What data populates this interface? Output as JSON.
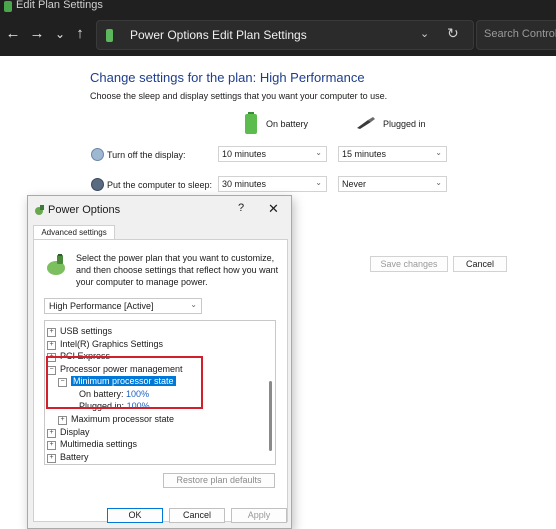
{
  "window": {
    "title": "Edit Plan Settings"
  },
  "nav": {
    "back": "←",
    "forward": "→",
    "recent": "⌄",
    "up": "↑",
    "breadcrumb": [
      "Power Options",
      "Edit Plan Settings"
    ],
    "separator": "›",
    "dropdown": "⌄",
    "refresh": "↻",
    "search_placeholder": "Search Control Pa"
  },
  "main": {
    "heading": "Change settings for the plan: High Performance",
    "subtext": "Choose the sleep and display settings that you want your computer to use.",
    "on_battery": "On battery",
    "plugged_in": "Plugged in",
    "rows": [
      {
        "label": "Turn off the display:",
        "battery": "10 minutes",
        "plugged": "15 minutes"
      },
      {
        "label": "Put the computer to sleep:",
        "battery": "30 minutes",
        "plugged": "Never"
      }
    ],
    "save_changes": "Save changes",
    "cancel": "Cancel"
  },
  "dialog": {
    "title": "Power Options",
    "help": "?",
    "close": "✕",
    "tab": "Advanced settings",
    "description": "Select the power plan that you want to customize, and then choose settings that reflect how you want your computer to manage power.",
    "plan": "High Performance [Active]",
    "tree": [
      {
        "expander": "⊞",
        "label": "USB settings"
      },
      {
        "expander": "⊞",
        "label": "Intel(R) Graphics Settings"
      },
      {
        "expander": "⊞",
        "label": "PCI Express"
      },
      {
        "expander": "⊟",
        "label": "Processor power management"
      },
      {
        "expander": "⊟",
        "label": "Minimum processor state"
      },
      {
        "label": "On battery:",
        "value": "100%"
      },
      {
        "label": "Plugged in:",
        "value": "100%"
      },
      {
        "expander": "⊞",
        "label": "Maximum processor state"
      },
      {
        "expander": "⊞",
        "label": "Display"
      },
      {
        "expander": "⊞",
        "label": "Multimedia settings"
      },
      {
        "expander": "⊞",
        "label": "Battery"
      }
    ],
    "restore": "Restore plan defaults",
    "ok": "OK",
    "cancel": "Cancel",
    "apply": "Apply"
  },
  "colors": {
    "accent": "#0078d7",
    "heading": "#1e3e8c",
    "highlight": "#d21f2b"
  }
}
